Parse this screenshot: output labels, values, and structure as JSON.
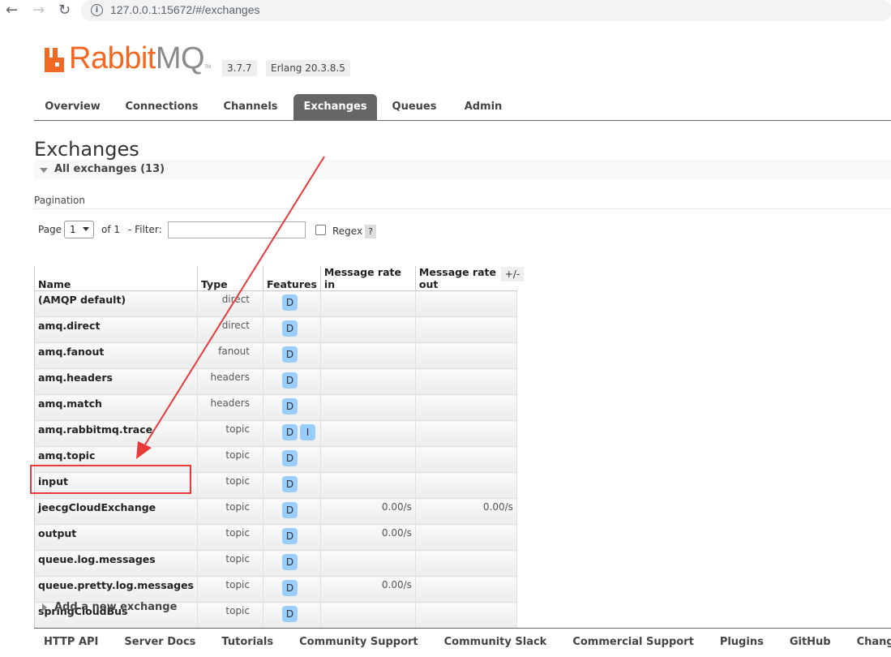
{
  "browser": {
    "url": "127.0.0.1:15672/#/exchanges"
  },
  "header": {
    "logo_rabbit": "Rabbit",
    "logo_mq": "MQ",
    "logo_tm": "TM",
    "version": "3.7.7",
    "erlang": "Erlang 20.3.8.5"
  },
  "tabs": [
    {
      "label": "Overview"
    },
    {
      "label": "Connections"
    },
    {
      "label": "Channels"
    },
    {
      "label": "Exchanges",
      "active": true
    },
    {
      "label": "Queues"
    },
    {
      "label": "Admin"
    }
  ],
  "page_title": "Exchanges",
  "section_title": "All exchanges (13)",
  "pagination": {
    "label": "Pagination",
    "page_label": "Page",
    "page_value": "1",
    "of_label": "of 1",
    "filter_label": "- Filter:",
    "filter_value": "",
    "regex_label": "Regex",
    "help": "?"
  },
  "table": {
    "headers": {
      "name": "Name",
      "type": "Type",
      "features": "Features",
      "rate_in": "Message rate in",
      "rate_out": "Message rate out"
    },
    "toggle_columns": "+/-",
    "rows": [
      {
        "name": "(AMQP default)",
        "type": "direct",
        "features": [
          "D"
        ],
        "rate_in": "",
        "rate_out": ""
      },
      {
        "name": "amq.direct",
        "type": "direct",
        "features": [
          "D"
        ],
        "rate_in": "",
        "rate_out": ""
      },
      {
        "name": "amq.fanout",
        "type": "fanout",
        "features": [
          "D"
        ],
        "rate_in": "",
        "rate_out": ""
      },
      {
        "name": "amq.headers",
        "type": "headers",
        "features": [
          "D"
        ],
        "rate_in": "",
        "rate_out": ""
      },
      {
        "name": "amq.match",
        "type": "headers",
        "features": [
          "D"
        ],
        "rate_in": "",
        "rate_out": ""
      },
      {
        "name": "amq.rabbitmq.trace",
        "type": "topic",
        "features": [
          "D",
          "I"
        ],
        "rate_in": "",
        "rate_out": ""
      },
      {
        "name": "amq.topic",
        "type": "topic",
        "features": [
          "D"
        ],
        "rate_in": "",
        "rate_out": ""
      },
      {
        "name": "input",
        "type": "topic",
        "features": [
          "D"
        ],
        "rate_in": "",
        "rate_out": ""
      },
      {
        "name": "jeecgCloudExchange",
        "type": "topic",
        "features": [
          "D"
        ],
        "rate_in": "0.00/s",
        "rate_out": "0.00/s"
      },
      {
        "name": "output",
        "type": "topic",
        "features": [
          "D"
        ],
        "rate_in": "0.00/s",
        "rate_out": ""
      },
      {
        "name": "queue.log.messages",
        "type": "topic",
        "features": [
          "D"
        ],
        "rate_in": "",
        "rate_out": ""
      },
      {
        "name": "queue.pretty.log.messages",
        "type": "topic",
        "features": [
          "D"
        ],
        "rate_in": "0.00/s",
        "rate_out": ""
      },
      {
        "name": "springCloudBus",
        "type": "topic",
        "features": [
          "D"
        ],
        "rate_in": "",
        "rate_out": ""
      }
    ]
  },
  "add_exchange": "Add a new exchange",
  "footer_links": [
    "HTTP API",
    "Server Docs",
    "Tutorials",
    "Community Support",
    "Community Slack",
    "Commercial Support",
    "Plugins",
    "GitHub",
    "Changelog"
  ],
  "colors": {
    "brand_orange": "#f26722",
    "tab_active": "#666666",
    "badge_blue": "#99ccff",
    "annotation_red": "#e83a3a"
  }
}
